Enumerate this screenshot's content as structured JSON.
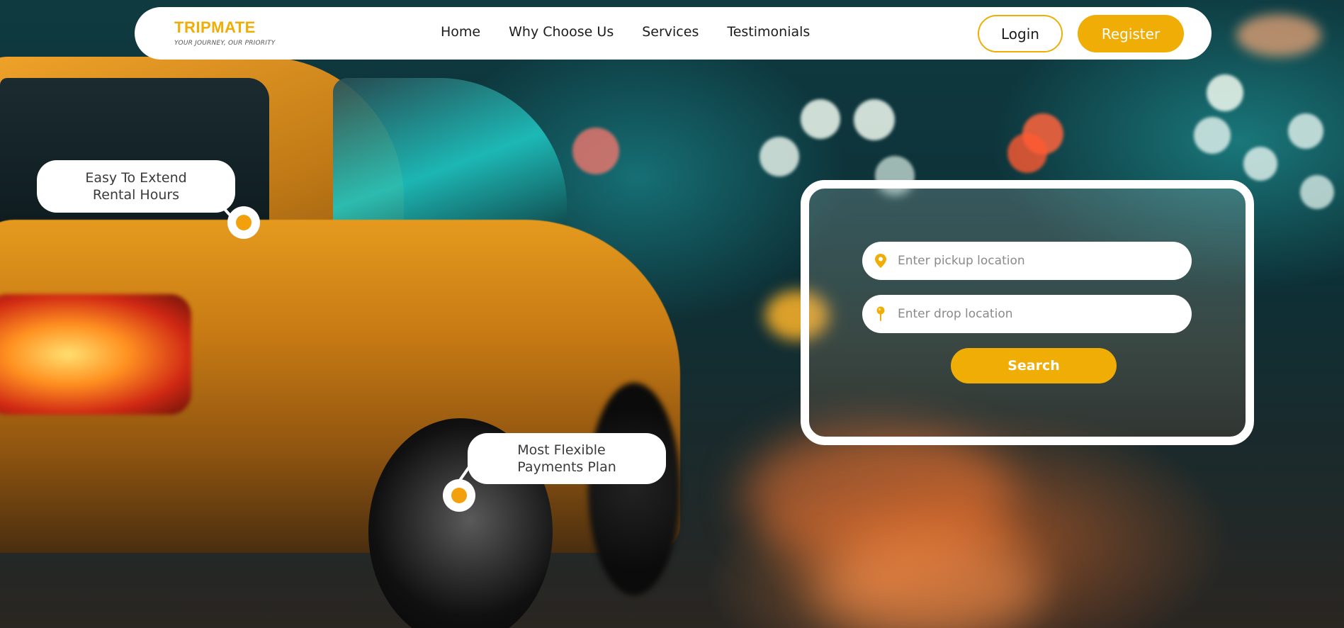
{
  "brand": {
    "name": "TRIPMATE",
    "tagline": "YOUR JOURNEY, OUR PRIORITY",
    "accent_color": "#f0ad06"
  },
  "nav": {
    "links": [
      "Home",
      "Why Choose Us",
      "Services",
      "Testimonials"
    ],
    "login_label": "Login",
    "register_label": "Register"
  },
  "callouts": {
    "first": {
      "line1": "Easy To Extend",
      "line2": "Rental Hours"
    },
    "second": {
      "line1": "Most Flexible",
      "line2": "Payments Plan"
    }
  },
  "search": {
    "pickup_placeholder": "Enter pickup location",
    "pickup_icon": "map-pin-icon",
    "drop_placeholder": "Enter drop location",
    "drop_icon": "pushpin-icon",
    "button_label": "Search"
  }
}
